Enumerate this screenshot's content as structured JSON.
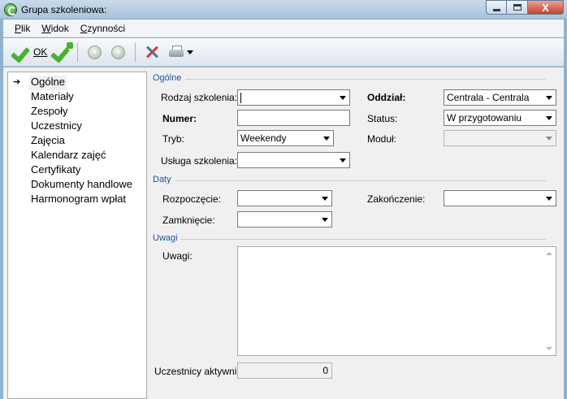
{
  "window": {
    "title": "Grupa szkoleniowa:",
    "close_glyph": "X"
  },
  "menu": [
    {
      "u": "P",
      "rest": "lik"
    },
    {
      "u": "W",
      "rest": "idok"
    },
    {
      "u": "C",
      "rest": "zynności"
    }
  ],
  "toolbar": {
    "ok_label": "OK"
  },
  "nav": {
    "selected_arrow": "➔",
    "items": [
      "Ogólne",
      "Materiały",
      "Zespoły",
      "Uczestnicy",
      "Zajęcia",
      "Kalendarz zajęć",
      "Certyfikaty",
      "Dokumenty handlowe",
      "Harmonogram wpłat"
    ]
  },
  "sections": {
    "general": "Ogólne",
    "dates": "Daty",
    "notes": "Uwagi"
  },
  "form": {
    "rodzaj_label": "Rodzaj szkolenia:",
    "rodzaj_value": "",
    "numer_label": "Numer:",
    "numer_value": "",
    "tryb_label": "Tryb:",
    "tryb_value": "Weekendy",
    "usluga_label": "Usługa szkolenia:",
    "usluga_value": "",
    "oddzial_label": "Oddział:",
    "oddzial_value": "Centrala - Centrala",
    "status_label": "Status:",
    "status_value": "W przygotowaniu",
    "modul_label": "Moduł:",
    "modul_value": "",
    "rozpoczecie_label": "Rozpoczęcie:",
    "zakonczenie_label": "Zakończenie:",
    "zamkniecie_label": "Zamknięcie:",
    "uwagi_label": "Uwagi:",
    "uwagi_value": "",
    "uczestnicy_label": "Uczestnicy aktywni:",
    "uczestnicy_value": "0"
  }
}
